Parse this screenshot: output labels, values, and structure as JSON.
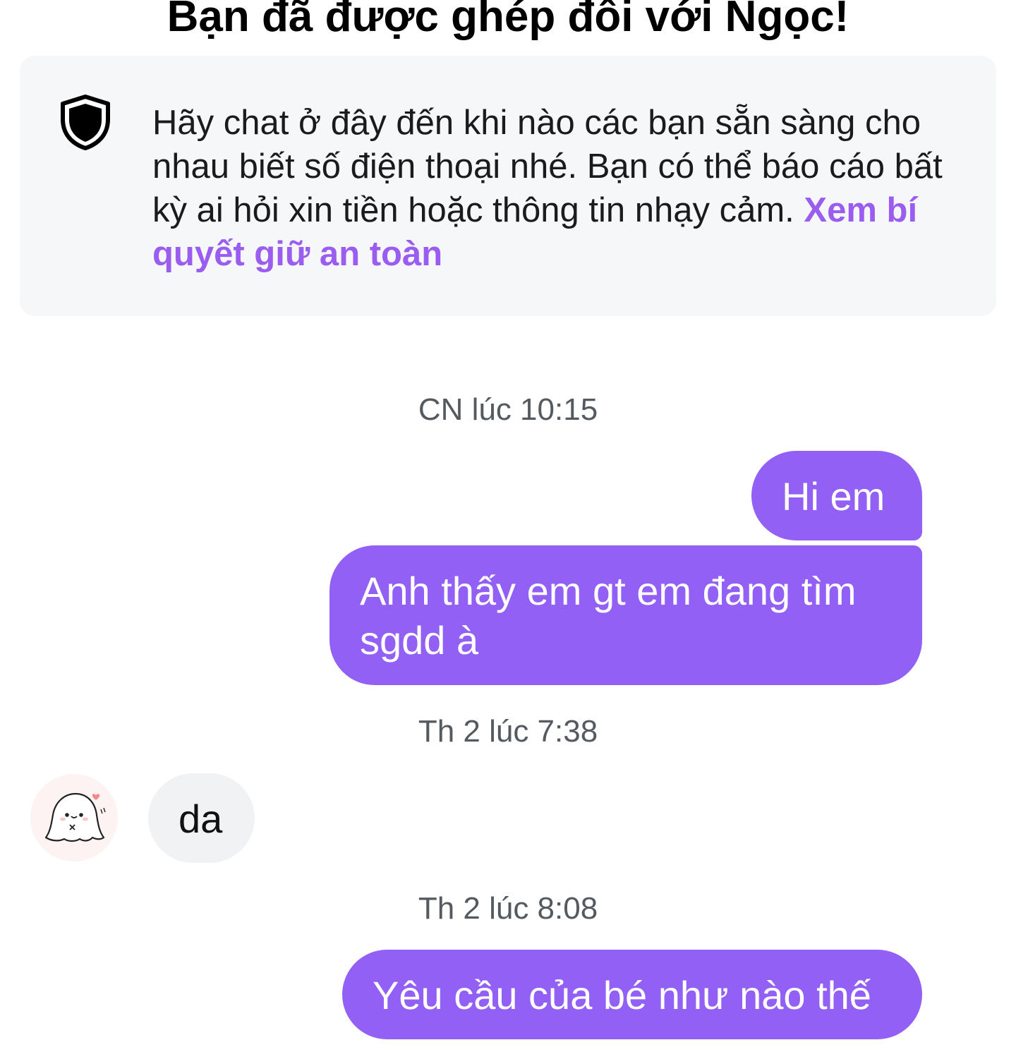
{
  "header": {
    "title": "Bạn đã được ghép đôi với Ngọc!"
  },
  "safety_notice": {
    "icon": "shield-icon",
    "text": "Hãy chat ở đây đến khi nào các bạn sẵn sàng cho nhau biết số điện thoại nhé. Bạn có thể báo cáo bất kỳ ai hỏi xin tiền hoặc thông tin nhạy cảm.",
    "link_label": "Xem bí quyết giữ an toàn"
  },
  "conversation": [
    {
      "type": "timestamp",
      "text": "CN lúc 10:15"
    },
    {
      "type": "sent",
      "text": "Hi em"
    },
    {
      "type": "sent",
      "text": "Anh thấy em gt em đang tìm sgdd à"
    },
    {
      "type": "timestamp",
      "text": "Th 2 lúc 7:38"
    },
    {
      "type": "received",
      "text": "da",
      "avatar": "ghost-avatar"
    },
    {
      "type": "timestamp",
      "text": "Th 2 lúc 8:08"
    },
    {
      "type": "sent",
      "text": "Yêu cầu của bé như nào thế"
    }
  ],
  "colors": {
    "accent": "#9260f5",
    "link": "#9b5cf0",
    "card_background": "#f6f7f9",
    "received_bubble": "#f1f2f4",
    "timestamp_text": "#555a60"
  }
}
